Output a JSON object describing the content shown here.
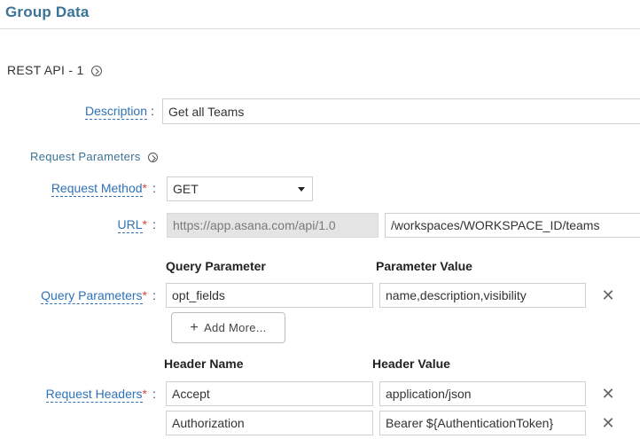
{
  "page_title": "Group Data",
  "section": {
    "title": "REST API - 1"
  },
  "description": {
    "label": "Description",
    "value": "Get all Teams"
  },
  "request_parameters": {
    "title": "Request Parameters"
  },
  "request_method": {
    "label": "Request Method",
    "value": "GET"
  },
  "url": {
    "label": "URL",
    "base": "https://app.asana.com/api/1.0",
    "path": "/workspaces/WORKSPACE_ID/teams"
  },
  "query_parameters": {
    "label": "Query Parameters",
    "col_name": "Query Parameter",
    "col_value": "Parameter Value",
    "rows": [
      {
        "name": "opt_fields",
        "value": "name,description,visibility"
      }
    ],
    "add_more_label": "Add More..."
  },
  "request_headers": {
    "label": "Request Headers",
    "col_name": "Header Name",
    "col_value": "Header Value",
    "rows": [
      {
        "name": "Accept",
        "value": "application/json"
      },
      {
        "name": "Authorization",
        "value": "Bearer ${AuthenticationToken}"
      }
    ]
  },
  "required_marker": "*",
  "colon": ":",
  "icons": {
    "info": "chevron-circle-icon",
    "delete": "close-icon",
    "add": "plus-icon",
    "dropdown": "caret-down-icon"
  },
  "colors": {
    "accent": "#3c7397",
    "link": "#2f72b5",
    "required": "#e0453b"
  }
}
